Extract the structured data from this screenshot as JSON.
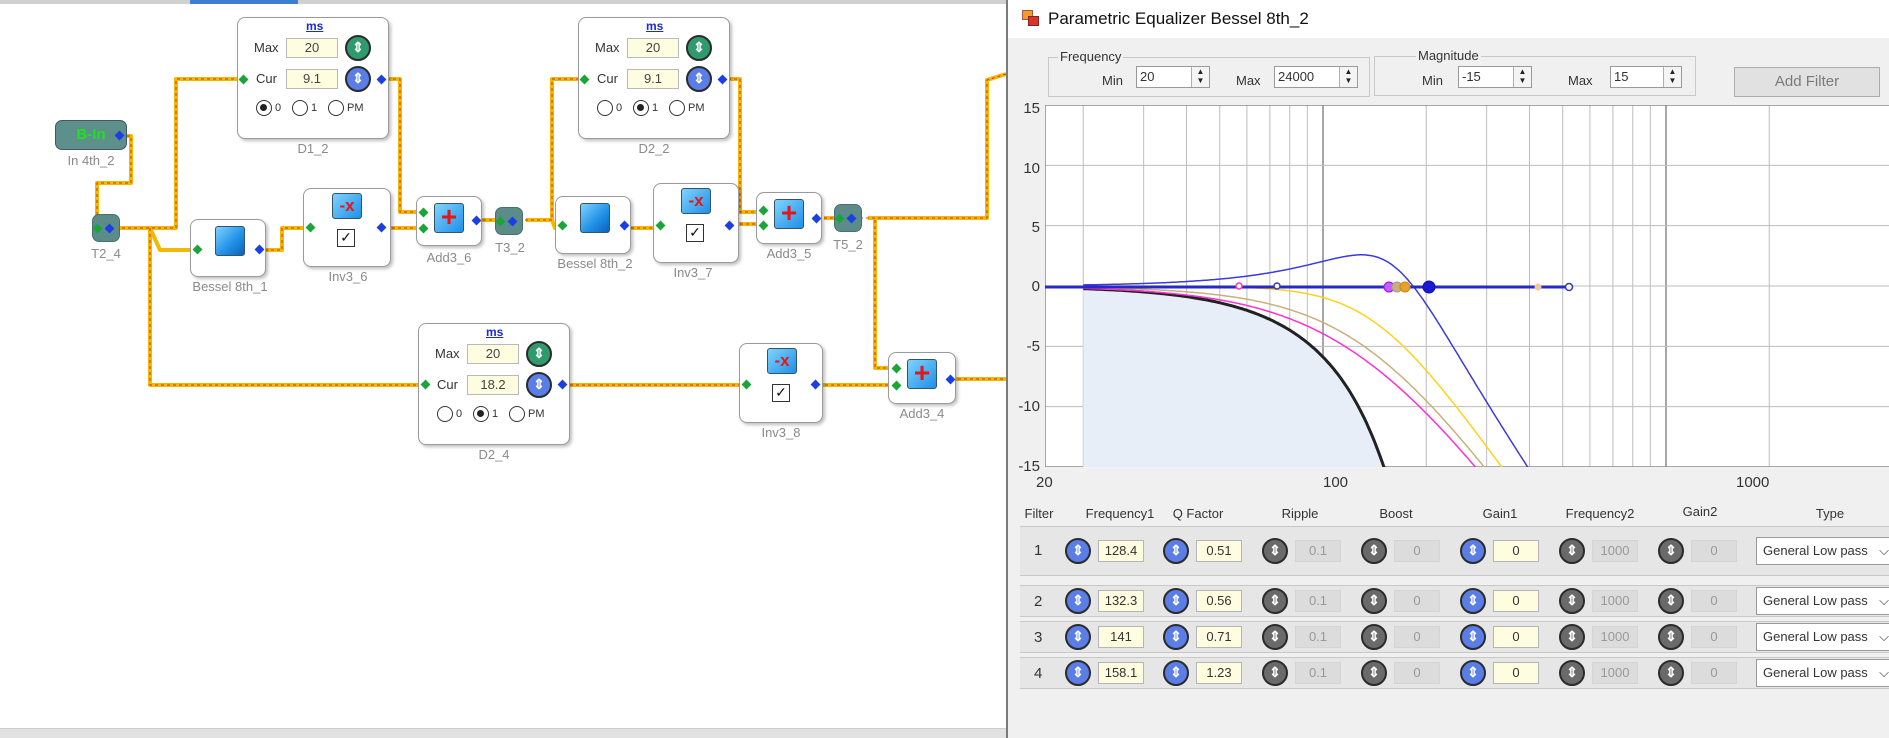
{
  "canvas": {
    "blocks": {
      "bin": {
        "text": "B-In",
        "label": "In 4th_2"
      },
      "t2_4": {
        "label": "T2_4"
      },
      "bessel1": {
        "label": "Bessel 8th_1"
      },
      "inv3_6": {
        "label": "Inv3_6"
      },
      "add3_6": {
        "label": "Add3_6"
      },
      "t3_2": {
        "label": "T3_2"
      },
      "bessel2": {
        "label": "Bessel 8th_2"
      },
      "inv3_7": {
        "label": "Inv3_7"
      },
      "add3_5": {
        "label": "Add3_5"
      },
      "t5_2": {
        "label": "T5_2"
      },
      "inv3_8": {
        "label": "Inv3_8"
      },
      "add3_4": {
        "label": "Add3_4"
      }
    },
    "delays": [
      {
        "label": "D1_2",
        "unit": "ms",
        "max_label": "Max",
        "max": "20",
        "cur_label": "Cur",
        "cur": "9.1",
        "r0": "0",
        "r1": "1",
        "rpm": "PM",
        "selected": 0
      },
      {
        "label": "D2_2",
        "unit": "ms",
        "max_label": "Max",
        "max": "20",
        "cur_label": "Cur",
        "cur": "9.1",
        "r0": "0",
        "r1": "1",
        "rpm": "PM",
        "selected": 1
      },
      {
        "label": "D2_4",
        "unit": "ms",
        "max_label": "Max",
        "max": "20",
        "cur_label": "Cur",
        "cur": "18.2",
        "r0": "0",
        "r1": "1",
        "rpm": "PM",
        "selected": 1
      }
    ]
  },
  "eq": {
    "title": "Parametric Equalizer Bessel 8th_2",
    "frequency": {
      "group": "Frequency",
      "min_label": "Min",
      "min": "20",
      "max_label": "Max",
      "max": "24000"
    },
    "magnitude": {
      "group": "Magnitude",
      "min_label": "Min",
      "min": "-15",
      "max_label": "Max",
      "max": "15"
    },
    "add_filter": "Add Filter",
    "chart": {
      "y_ticks": [
        "15",
        "10",
        "5",
        "0",
        "-5",
        "-10",
        "-15"
      ],
      "x_ticks": [
        "20",
        "100",
        "1000"
      ]
    },
    "columns": [
      "Filter",
      "Frequency1",
      "Q Factor",
      "Ripple",
      "Boost",
      "Gain1",
      "Frequency2",
      "Gain2",
      "Type"
    ],
    "filters": [
      {
        "n": "1",
        "frequency1": "128.4",
        "q": "0.51",
        "ripple": "0.1",
        "boost": "0",
        "gain1": "0",
        "frequency2": "1000",
        "gain2": "0",
        "type": "General Low pass"
      },
      {
        "n": "2",
        "frequency1": "132.3",
        "q": "0.56",
        "ripple": "0.1",
        "boost": "0",
        "gain1": "0",
        "frequency2": "1000",
        "gain2": "0",
        "type": "General Low pass"
      },
      {
        "n": "3",
        "frequency1": "141",
        "q": "0.71",
        "ripple": "0.1",
        "boost": "0",
        "gain1": "0",
        "frequency2": "1000",
        "gain2": "0",
        "type": "General Low pass"
      },
      {
        "n": "4",
        "frequency1": "158.1",
        "q": "1.23",
        "ripple": "0.1",
        "boost": "0",
        "gain1": "0",
        "frequency2": "1000",
        "gain2": "0",
        "type": "General Low pass"
      }
    ],
    "icons": {
      "knob": "adjust-knob-icon",
      "dropdown": "chevron-down-icon",
      "window": "app-window-icon"
    },
    "colors": {
      "wire": "#f5b800",
      "curve_total": "#3a3ae0",
      "curve_1": "#ff2fd2",
      "curve_2": "#c8b07a",
      "curve_3": "#ffd21a",
      "curve_ref": "#222222",
      "fill": "#e8eef8"
    }
  }
}
